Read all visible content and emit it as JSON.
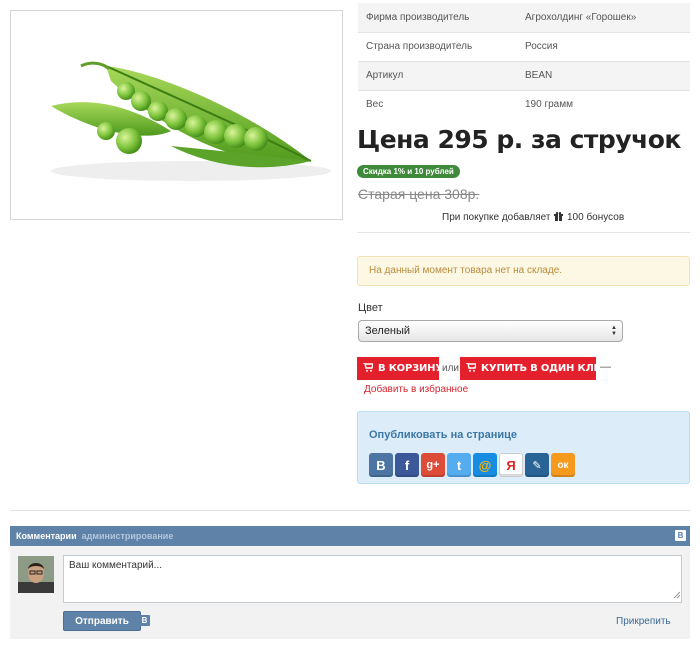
{
  "specs": [
    {
      "label": "Фирма производитель",
      "value": "Агрохолдинг «Горошек»"
    },
    {
      "label": "Страна производитель",
      "value": "Россия"
    },
    {
      "label": "Артикул",
      "value": "BEAN"
    },
    {
      "label": "Вес",
      "value": "190 грамм"
    }
  ],
  "price": {
    "title": "Цена 295 р. за стручок",
    "discount": "Скидка 1% и 10 рублей",
    "old_price": "Старая цена 308р.",
    "bonus_prefix": "При покупке добавляет",
    "bonus_suffix": "100 бонусов"
  },
  "stock_alert": "На данный момент товара нет на складе.",
  "color": {
    "label": "Цвет",
    "selected": "Зеленый"
  },
  "buttons": {
    "cart": "В КОРЗИНУ",
    "or": "или",
    "one_click": "КУПИТЬ В ОДИН КЛИК",
    "dash": "—",
    "favorite": "Добавить в избранное"
  },
  "share": {
    "title": "Опубликовать на странице",
    "networks": [
      {
        "name": "vkontakte",
        "glyph": "B",
        "color": "#4c75a3"
      },
      {
        "name": "facebook",
        "glyph": "f",
        "color": "#3b5998"
      },
      {
        "name": "google-plus",
        "glyph": "g+",
        "color": "#dd4b39"
      },
      {
        "name": "twitter",
        "glyph": "t",
        "color": "#55acee"
      },
      {
        "name": "mail-ru",
        "glyph": "@",
        "color": "#168de2"
      },
      {
        "name": "yandex",
        "glyph": "Я",
        "color": "#ffffff"
      },
      {
        "name": "livejournal",
        "glyph": "✎",
        "color": "#2a6496"
      },
      {
        "name": "odnoklassniki",
        "glyph": "ок",
        "color": "#f59a1d"
      }
    ]
  },
  "comments": {
    "title": "Комментарии",
    "admin": "администрирование",
    "vk_badge": "B",
    "placeholder": "Ваш комментарий...",
    "send": "Отправить",
    "attach": "Прикрепить"
  },
  "colors": {
    "red": "#e4202d",
    "green_badge": "#3f8a3a",
    "vk_blue": "#5e82a8",
    "share_bg": "#dcedf9",
    "alert_bg": "#fcf8e3"
  }
}
